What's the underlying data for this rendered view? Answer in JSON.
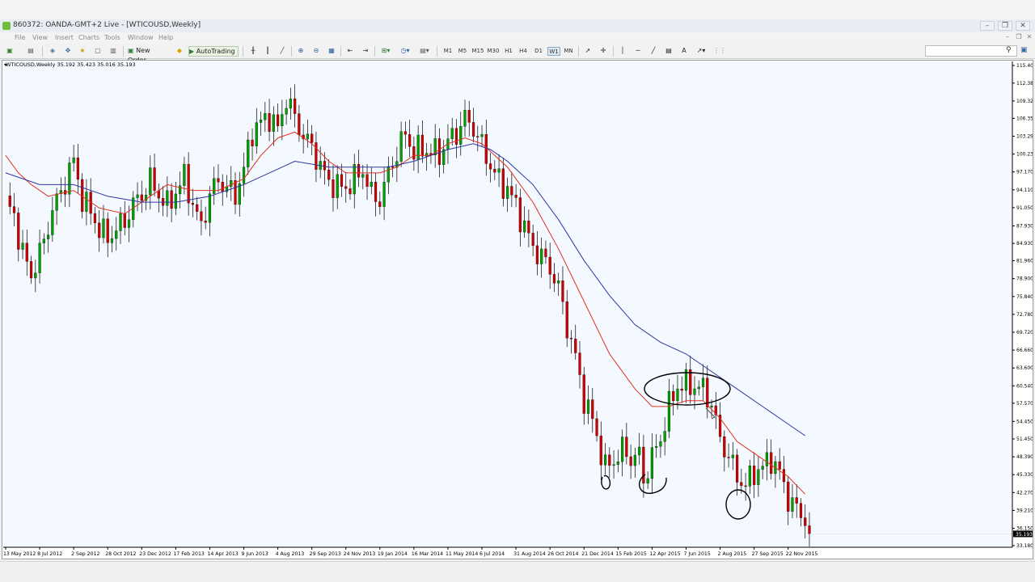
{
  "window": {
    "title": "860372: OANDA-GMT+2 Live - [WTICOUSD,Weekly]",
    "controls": [
      "–",
      "❐",
      "✕"
    ]
  },
  "menu": {
    "items": [
      "File",
      "View",
      "Insert",
      "Charts",
      "Tools",
      "Window",
      "Help"
    ]
  },
  "toolbar": {
    "new_order_label": "New Order",
    "autotrading_label": "AutoTrading",
    "timeframes": [
      "M1",
      "M5",
      "M15",
      "M30",
      "H1",
      "H4",
      "D1",
      "W1",
      "MN"
    ],
    "active_timeframe": "W1"
  },
  "chart_data": {
    "type": "candlestick",
    "symbol_info": "WTICOUSD,Weekly  35.192 35.423 35.016 35.193",
    "ylim": [
      33.18,
      115.4
    ],
    "y_ticks": [
      115.4,
      112.38,
      109.32,
      106.35,
      103.29,
      100.23,
      97.17,
      94.11,
      91.05,
      87.93,
      84.93,
      81.96,
      78.9,
      75.84,
      72.78,
      69.72,
      66.66,
      63.6,
      60.54,
      57.57,
      54.45,
      51.45,
      48.39,
      45.33,
      42.27,
      39.21,
      36.15,
      33.18
    ],
    "y_tick_labels": [
      "115.400",
      "112.380",
      "109.320",
      "106.350",
      "103.290",
      "100.230",
      "97.170",
      "94.110",
      "91.050",
      "87.930",
      "84.930",
      "81.960",
      "78.900",
      "75.840",
      "72.780",
      "69.720",
      "66.660",
      "63.600",
      "60.540",
      "57.570",
      "54.450",
      "51.450",
      "48.390",
      "45.330",
      "42.270",
      "39.210",
      "36.150",
      "33.180"
    ],
    "current_price_label": "35.193",
    "current_price": 35.193,
    "x_labels": [
      "13 May 2012",
      "8 Jul 2012",
      "2 Sep 2012",
      "28 Oct 2012",
      "23 Dec 2012",
      "17 Feb 2013",
      "14 Apr 2013",
      "9 Jun 2013",
      "4 Aug 2013",
      "29 Sep 2013",
      "24 Nov 2013",
      "19 Jan 2014",
      "16 Mar 2014",
      "11 May 2014",
      "6 Jul 2014",
      "31 Aug 2014",
      "26 Oct 2014",
      "21 Dec 2014",
      "15 Feb 2015",
      "12 Apr 2015",
      "7 Jun 2015",
      "2 Aug 2015",
      "27 Sep 2015",
      "22 Nov 2015"
    ],
    "x_label_bar_index": [
      0,
      8,
      16,
      24,
      32,
      40,
      48,
      56,
      64,
      72,
      80,
      88,
      96,
      104,
      112,
      120,
      128,
      136,
      144,
      152,
      160,
      168,
      176,
      184
    ],
    "bar_count": 190,
    "close_path": [
      [
        0,
        92
      ],
      [
        2,
        90
      ],
      [
        4,
        84
      ],
      [
        6,
        80
      ],
      [
        9,
        85
      ],
      [
        11,
        90
      ],
      [
        13,
        93
      ],
      [
        15,
        97
      ],
      [
        16,
        99
      ],
      [
        18,
        93
      ],
      [
        20,
        91
      ],
      [
        22,
        88
      ],
      [
        24,
        86
      ],
      [
        26,
        87
      ],
      [
        28,
        88
      ],
      [
        30,
        91
      ],
      [
        32,
        93
      ],
      [
        34,
        96
      ],
      [
        36,
        94
      ],
      [
        38,
        92
      ],
      [
        40,
        94
      ],
      [
        42,
        96
      ],
      [
        44,
        91
      ],
      [
        46,
        87
      ],
      [
        48,
        93
      ],
      [
        50,
        96
      ],
      [
        52,
        95
      ],
      [
        54,
        94
      ],
      [
        56,
        98
      ],
      [
        58,
        104
      ],
      [
        60,
        105
      ],
      [
        62,
        106
      ],
      [
        64,
        104
      ],
      [
        66,
        110
      ],
      [
        68,
        107
      ],
      [
        70,
        104
      ],
      [
        72,
        102
      ],
      [
        74,
        98
      ],
      [
        76,
        95
      ],
      [
        78,
        94
      ],
      [
        80,
        94
      ],
      [
        82,
        96
      ],
      [
        84,
        98
      ],
      [
        86,
        94
      ],
      [
        88,
        93
      ],
      [
        90,
        97
      ],
      [
        92,
        100
      ],
      [
        94,
        103
      ],
      [
        96,
        100
      ],
      [
        98,
        101
      ],
      [
        100,
        101
      ],
      [
        102,
        101
      ],
      [
        104,
        103
      ],
      [
        106,
        104
      ],
      [
        108,
        106
      ],
      [
        110,
        104
      ],
      [
        112,
        101
      ],
      [
        114,
        98
      ],
      [
        116,
        96
      ],
      [
        118,
        95
      ],
      [
        120,
        92
      ],
      [
        122,
        88
      ],
      [
        124,
        84
      ],
      [
        126,
        82
      ],
      [
        128,
        80
      ],
      [
        130,
        77
      ],
      [
        132,
        71
      ],
      [
        134,
        66
      ],
      [
        136,
        59
      ],
      [
        138,
        55
      ],
      [
        140,
        49
      ],
      [
        141,
        46
      ],
      [
        143,
        47
      ],
      [
        145,
        49
      ],
      [
        147,
        48
      ],
      [
        149,
        49
      ],
      [
        150,
        45
      ],
      [
        152,
        49
      ],
      [
        154,
        52
      ],
      [
        156,
        57
      ],
      [
        158,
        60
      ],
      [
        160,
        60
      ],
      [
        162,
        60
      ],
      [
        164,
        60
      ],
      [
        166,
        58
      ],
      [
        168,
        52
      ],
      [
        170,
        49
      ],
      [
        172,
        45
      ],
      [
        174,
        43
      ],
      [
        176,
        45
      ],
      [
        178,
        46
      ],
      [
        180,
        48
      ],
      [
        182,
        46
      ],
      [
        184,
        42
      ],
      [
        186,
        40
      ],
      [
        188,
        38
      ],
      [
        189,
        35.2
      ]
    ],
    "ma_fast": {
      "color": "#e0301f",
      "points": [
        [
          0,
          100
        ],
        [
          3,
          97
        ],
        [
          6,
          95
        ],
        [
          10,
          93
        ],
        [
          16,
          94
        ],
        [
          22,
          91
        ],
        [
          28,
          90
        ],
        [
          34,
          93
        ],
        [
          38,
          95
        ],
        [
          44,
          94
        ],
        [
          50,
          94
        ],
        [
          56,
          96
        ],
        [
          60,
          100
        ],
        [
          64,
          103
        ],
        [
          68,
          104
        ],
        [
          72,
          102
        ],
        [
          76,
          99
        ],
        [
          80,
          97
        ],
        [
          84,
          97
        ],
        [
          88,
          97
        ],
        [
          92,
          98
        ],
        [
          96,
          100
        ],
        [
          100,
          100
        ],
        [
          104,
          102
        ],
        [
          108,
          103
        ],
        [
          112,
          102
        ],
        [
          118,
          98
        ],
        [
          124,
          92
        ],
        [
          130,
          84
        ],
        [
          136,
          75
        ],
        [
          142,
          66
        ],
        [
          148,
          60
        ],
        [
          152,
          57
        ],
        [
          156,
          57
        ],
        [
          160,
          58
        ],
        [
          164,
          58
        ],
        [
          168,
          55
        ],
        [
          172,
          51
        ],
        [
          176,
          49
        ],
        [
          180,
          47
        ],
        [
          184,
          45
        ],
        [
          188,
          42
        ]
      ]
    },
    "ma_slow": {
      "color": "#3035a0",
      "points": [
        [
          0,
          97
        ],
        [
          8,
          95
        ],
        [
          16,
          95
        ],
        [
          24,
          93
        ],
        [
          32,
          92
        ],
        [
          40,
          92
        ],
        [
          48,
          93
        ],
        [
          56,
          95
        ],
        [
          62,
          97
        ],
        [
          68,
          99
        ],
        [
          76,
          98
        ],
        [
          84,
          98
        ],
        [
          90,
          98
        ],
        [
          96,
          99
        ],
        [
          104,
          101
        ],
        [
          110,
          102
        ],
        [
          114,
          101
        ],
        [
          118,
          99
        ],
        [
          124,
          95
        ],
        [
          130,
          89
        ],
        [
          136,
          82
        ],
        [
          142,
          76
        ],
        [
          148,
          71
        ],
        [
          154,
          68
        ],
        [
          160,
          66
        ],
        [
          166,
          63
        ],
        [
          172,
          60
        ],
        [
          178,
          57
        ],
        [
          184,
          54
        ],
        [
          188,
          52
        ]
      ]
    },
    "bull_color": "#00a000",
    "bear_color": "#d00000"
  }
}
